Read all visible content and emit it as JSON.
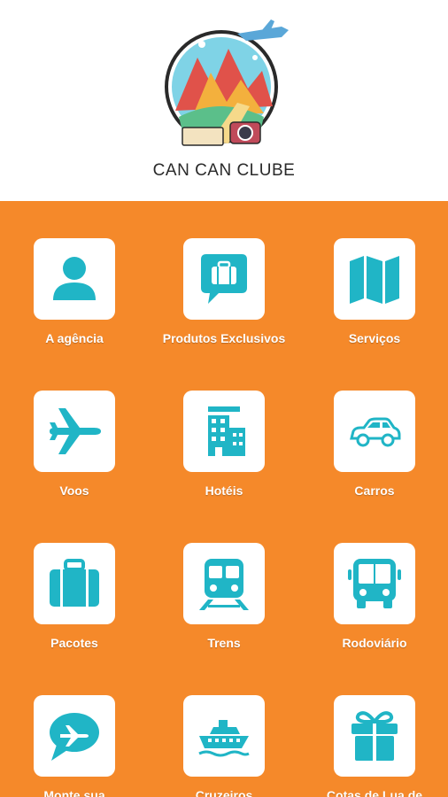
{
  "brand": {
    "name": "CAN CAN CLUBE"
  },
  "colors": {
    "background": "#f5892a",
    "icon": "#20b5c6",
    "tile": "#ffffff"
  },
  "tiles": [
    {
      "label": "A agência",
      "icon": "person-icon"
    },
    {
      "label": "Produtos Exclusivos",
      "icon": "suitcase-chat-icon"
    },
    {
      "label": "Serviços",
      "icon": "map-icon"
    },
    {
      "label": "Voos",
      "icon": "airplane-icon"
    },
    {
      "label": "Hotéis",
      "icon": "hotel-icon"
    },
    {
      "label": "Carros",
      "icon": "car-icon"
    },
    {
      "label": "Pacotes",
      "icon": "luggage-icon"
    },
    {
      "label": "Trens",
      "icon": "train-icon"
    },
    {
      "label": "Rodoviário",
      "icon": "bus-icon"
    },
    {
      "label": "Monte sua",
      "icon": "plane-chat-icon"
    },
    {
      "label": "Cruzeiros",
      "icon": "ship-icon"
    },
    {
      "label": "Cotas de Lua de",
      "icon": "gift-icon"
    }
  ]
}
